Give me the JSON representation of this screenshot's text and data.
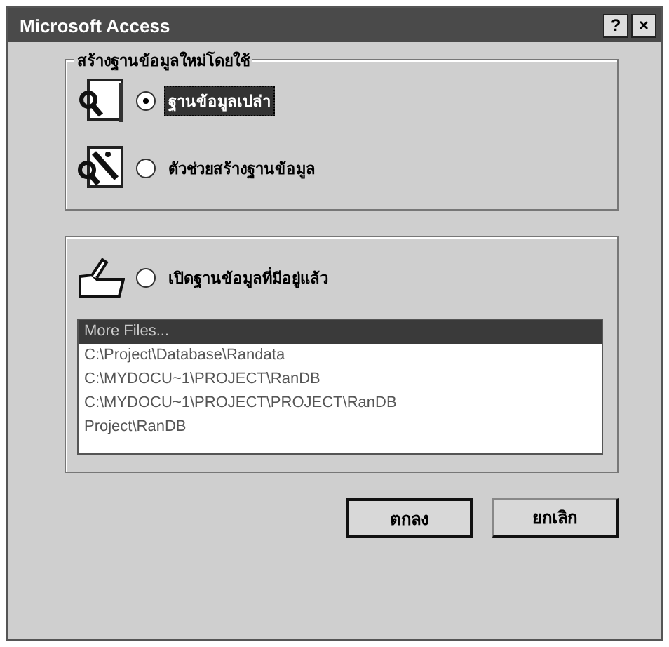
{
  "window": {
    "title": "Microsoft Access"
  },
  "title_buttons": [
    "?",
    "×"
  ],
  "new_group": {
    "label": "สร้างฐานข้อมูลใหม่โดยใช้",
    "options": [
      {
        "kind": "blank",
        "label": "ฐานข้อมูลเปล่า",
        "selected": true
      },
      {
        "kind": "wizard",
        "label": "ตัวช่วยสร้างฐานข้อมูล",
        "selected": false
      }
    ]
  },
  "open_group": {
    "option": {
      "label": "เปิดฐานข้อมูลที่มีอยู่แล้ว",
      "selected": false
    },
    "files": [
      {
        "label": "More Files...",
        "selected": true
      },
      {
        "label": "C:\\Project\\Database\\Randata",
        "selected": false
      },
      {
        "label": "C:\\MYDOCU~1\\PROJECT\\RanDB",
        "selected": false
      },
      {
        "label": "C:\\MYDOCU~1\\PROJECT\\PROJECT\\RanDB",
        "selected": false
      },
      {
        "label": "Project\\RanDB",
        "selected": false
      }
    ]
  },
  "buttons": [
    {
      "label": "ตกลง",
      "default": true
    },
    {
      "label": "ยกเลิก",
      "default": false
    }
  ]
}
